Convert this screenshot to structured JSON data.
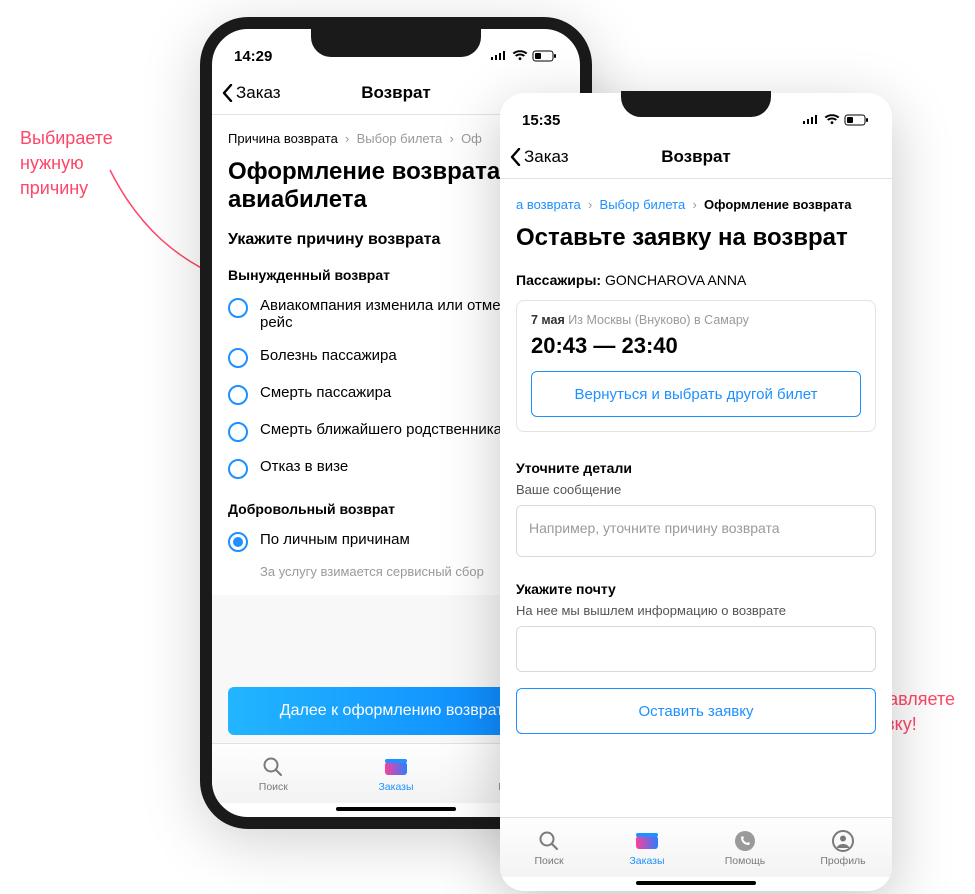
{
  "annotations": {
    "left": "Выбираете нужную причину",
    "right": "Оставляете заявку!"
  },
  "phone1": {
    "time": "14:29",
    "back": "Заказ",
    "title": "Возврат",
    "breadcrumb": {
      "a": "Причина возврата",
      "b": "Выбор билета",
      "c": "Оф"
    },
    "h1": "Оформление возврата авиабилета",
    "h2": "Укажите причину возврата",
    "forced_label": "Вынужденный возврат",
    "reasons_forced": [
      "Авиакомпания изменила или отменила рейс",
      "Болезнь пассажира",
      "Смерть пассажира",
      "Смерть ближайшего родственника",
      "Отказ в визе"
    ],
    "voluntary_label": "Добровольный возврат",
    "voluntary_reason": "По личным причинам",
    "voluntary_hint": "За услугу взимается сервисный сбор",
    "cta": "Далее к оформлению возврата",
    "tabs": [
      "Поиск",
      "Заказы",
      "Помощь"
    ]
  },
  "phone2": {
    "time": "15:35",
    "back": "Заказ",
    "title": "Возврат",
    "breadcrumb": {
      "a": "а возврата",
      "b": "Выбор билета",
      "c": "Оформление возврата"
    },
    "h1": "Оставьте заявку на возврат",
    "passengers_label": "Пассажиры:",
    "passengers_value": "GONCHAROVA ANNA",
    "ticket": {
      "date": "7 мая",
      "route": "Из Москвы (Внуково) в Самару",
      "times": "20:43 — 23:40",
      "change_btn": "Вернуться и выбрать другой билет"
    },
    "details_h": "Уточните детали",
    "details_sub": "Ваше сообщение",
    "details_placeholder": "Например, уточните причину возврата",
    "email_h": "Укажите почту",
    "email_sub": "На нее мы вышлем информацию о возврате",
    "cta": "Оставить заявку",
    "tabs": [
      "Поиск",
      "Заказы",
      "Помощь",
      "Профиль"
    ]
  }
}
